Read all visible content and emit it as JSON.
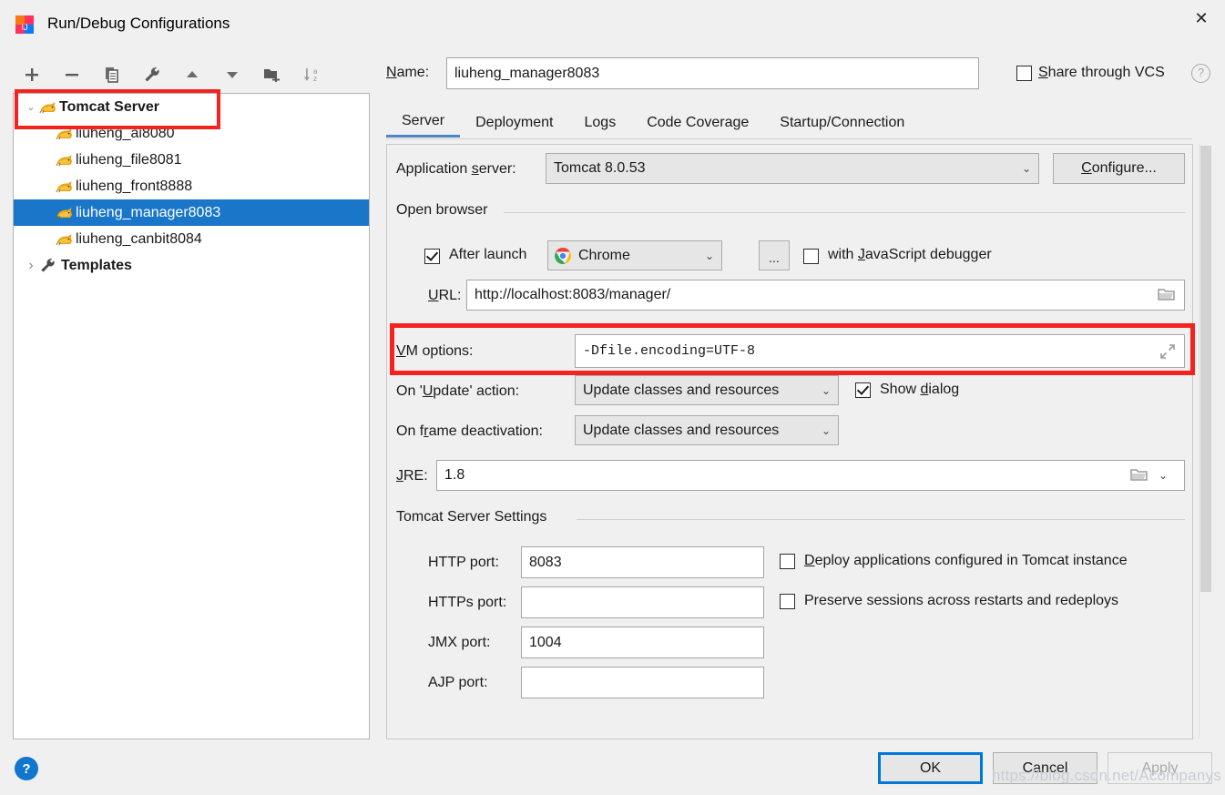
{
  "window": {
    "title": "Run/Debug Configurations",
    "app_icon": "intellij-idea-icon",
    "close_label": "✕"
  },
  "toolbar": {
    "items": [
      {
        "name": "add-configuration-button",
        "icon": "plus-icon",
        "glyph": "+"
      },
      {
        "name": "remove-configuration-button",
        "icon": "minus-icon",
        "glyph": "−"
      },
      {
        "name": "copy-configuration-button",
        "icon": "copy-icon",
        "glyph": "❐"
      },
      {
        "name": "edit-templates-button",
        "icon": "wrench-icon",
        "glyph": "🔧"
      },
      {
        "name": "move-up-button",
        "icon": "arrow-up-icon",
        "glyph": "▲"
      },
      {
        "name": "move-down-button",
        "icon": "arrow-down-icon",
        "glyph": "▼"
      },
      {
        "name": "new-folder-button",
        "icon": "folder-add-icon",
        "glyph": "🗀"
      },
      {
        "name": "sort-alphabetically-button",
        "icon": "sort-az-icon",
        "glyph": "↓az"
      }
    ]
  },
  "tree": {
    "group": {
      "label": "Tomcat Server",
      "icon": "tomcat-cat-icon",
      "expanded": true,
      "twisty": "⌄"
    },
    "children": [
      {
        "label": "liuheng_ai8080",
        "icon": "tomcat-cat-icon",
        "selected": false
      },
      {
        "label": "liuheng_file8081",
        "icon": "tomcat-cat-icon",
        "selected": false
      },
      {
        "label": "liuheng_front8888",
        "icon": "tomcat-cat-icon",
        "selected": false
      },
      {
        "label": "liuheng_manager8083",
        "icon": "tomcat-cat-icon",
        "selected": true
      },
      {
        "label": "liuheng_canbit8084",
        "icon": "tomcat-cat-icon",
        "selected": false
      }
    ],
    "templates": {
      "label": "Templates",
      "icon": "wrench-icon",
      "expanded": false,
      "twisty": "›"
    }
  },
  "header": {
    "name_label": "Name:",
    "name_label_accel": "N",
    "name_value": "liuheng_manager8083",
    "share_checkbox_label": "Share through VCS",
    "share_checkbox_accel": "S",
    "share_checked": false,
    "help_icon": "question-mark-icon",
    "help_glyph": "?"
  },
  "tabs": [
    {
      "label": "Server",
      "active": true
    },
    {
      "label": "Deployment",
      "active": false
    },
    {
      "label": "Logs",
      "active": false
    },
    {
      "label": "Code Coverage",
      "active": false
    },
    {
      "label": "Startup/Connection",
      "active": false
    }
  ],
  "server_tab": {
    "application_server": {
      "label": "Application server:",
      "label_accel": "s",
      "value": "Tomcat 8.0.53",
      "caret": "⌄",
      "configure_button": "Configure...",
      "configure_accel": "C"
    },
    "open_browser": {
      "group_title": "Open browser",
      "after_launch_label": "After launch",
      "after_launch_checked": true,
      "browser_value": "Chrome",
      "browser_icon": "chrome-icon",
      "browse_button": "...",
      "js_debugger_label": "with JavaScript debugger",
      "js_debugger_accel": "J",
      "js_debugger_checked": false,
      "url_label": "URL:",
      "url_accel": "U",
      "url_value": "http://localhost:8083/manager/",
      "url_browse_icon": "folder-icon"
    },
    "vm_options": {
      "label": "VM options:",
      "label_accel": "V",
      "value": "-Dfile.encoding=UTF-8",
      "expand_icon": "expand-diagonal-icon",
      "highlighted": true
    },
    "on_update_action": {
      "label": "On 'Update' action:",
      "label_accel": "U",
      "value": "Update classes and resources",
      "caret": "⌄",
      "show_dialog_label": "Show dialog",
      "show_dialog_accel": "d",
      "show_dialog_checked": true
    },
    "on_frame_deactivation": {
      "label": "On frame deactivation:",
      "label_accel": "r",
      "value": "Update classes and resources",
      "caret": "⌄"
    },
    "jre": {
      "label": "JRE:",
      "label_accel": "J",
      "value": "1.8",
      "folder_icon": "folder-icon",
      "caret": "⌄"
    },
    "tomcat_settings": {
      "group_title": "Tomcat Server Settings",
      "ports": [
        {
          "label": "HTTP port:",
          "value": "8083",
          "name": "http-port-input"
        },
        {
          "label": "HTTPs port:",
          "value": "",
          "name": "https-port-input"
        },
        {
          "label": "JMX port:",
          "value": "1004",
          "name": "jmx-port-input"
        },
        {
          "label": "AJP port:",
          "value": "",
          "name": "ajp-port-input"
        }
      ],
      "deploy_label": "Deploy applications configured in Tomcat instance",
      "deploy_accel": "D",
      "deploy_checked": false,
      "preserve_label": "Preserve sessions across restarts and redeploys",
      "preserve_checked": false
    }
  },
  "footer": {
    "help_icon": "question-mark-icon",
    "help_glyph": "?",
    "ok_label": "OK",
    "cancel_label": "Cancel",
    "apply_label": "Apply",
    "apply_disabled": true
  },
  "watermark": "https://blog.csdn.net/Acompanys",
  "colors": {
    "selection_blue": "#1976c8",
    "tab_underline": "#4a86c8",
    "annotation_red": "#f5231f",
    "focus_border": "#0078d7",
    "help_blue": "#1176cd"
  }
}
